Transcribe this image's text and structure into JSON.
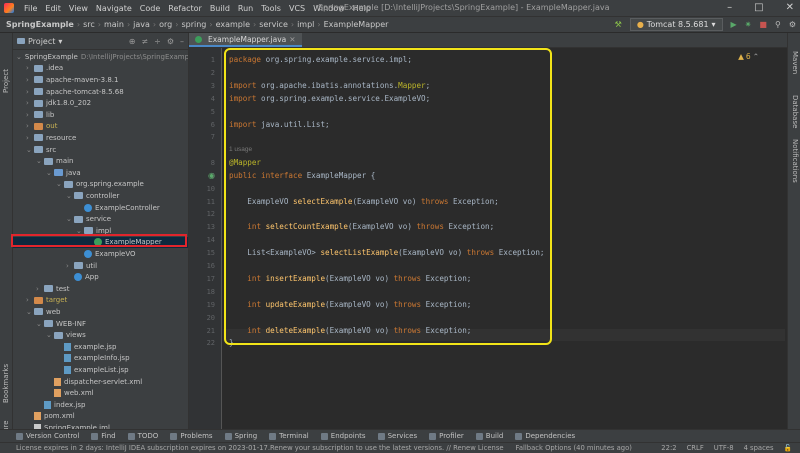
{
  "window": {
    "title": "SpringExample [D:\\IntelliJProjects\\SpringExample] - ExampleMapper.java"
  },
  "menu": [
    "File",
    "Edit",
    "View",
    "Navigate",
    "Code",
    "Refactor",
    "Build",
    "Run",
    "Tools",
    "VCS",
    "Window",
    "Help"
  ],
  "breadcrumbs": [
    "SpringExample",
    "src",
    "main",
    "java",
    "org",
    "spring",
    "example",
    "service",
    "impl",
    "ExampleMapper"
  ],
  "run_config": "Tomcat 8.5.681",
  "project_panel": {
    "title": "Project",
    "tree": [
      {
        "label": "SpringExample",
        "extra": "D:\\IntelliJProjects\\SpringExamp",
        "depth": 0,
        "icon": "folder",
        "open": true
      },
      {
        "label": ".idea",
        "depth": 1,
        "icon": "folder",
        "open": false
      },
      {
        "label": "apache-maven-3.8.1",
        "depth": 1,
        "icon": "folder",
        "open": false
      },
      {
        "label": "apache-tomcat-8.5.68",
        "depth": 1,
        "icon": "folder",
        "open": false
      },
      {
        "label": "jdk1.8.0_202",
        "depth": 1,
        "icon": "folder",
        "open": false
      },
      {
        "label": "lib",
        "depth": 1,
        "icon": "folder",
        "open": false
      },
      {
        "label": "out",
        "depth": 1,
        "icon": "folder-orange",
        "open": false
      },
      {
        "label": "resource",
        "depth": 1,
        "icon": "folder",
        "open": false
      },
      {
        "label": "src",
        "depth": 1,
        "icon": "folder",
        "open": true
      },
      {
        "label": "main",
        "depth": 2,
        "icon": "folder",
        "open": true
      },
      {
        "label": "java",
        "depth": 3,
        "icon": "folder-blue",
        "open": true
      },
      {
        "label": "org.spring.example",
        "depth": 4,
        "icon": "folder",
        "open": true
      },
      {
        "label": "controller",
        "depth": 5,
        "icon": "folder",
        "open": true
      },
      {
        "label": "ExampleController",
        "depth": 6,
        "icon": "class"
      },
      {
        "label": "service",
        "depth": 5,
        "icon": "folder",
        "open": true
      },
      {
        "label": "impl",
        "depth": 6,
        "icon": "folder",
        "open": true
      },
      {
        "label": "ExampleMapper",
        "depth": 7,
        "icon": "interface",
        "selected": true
      },
      {
        "label": "ExampleVO",
        "depth": 6,
        "icon": "class"
      },
      {
        "label": "util",
        "depth": 5,
        "icon": "folder",
        "open": false
      },
      {
        "label": "App",
        "depth": 5,
        "icon": "class"
      },
      {
        "label": "test",
        "depth": 2,
        "icon": "folder",
        "open": false
      },
      {
        "label": "target",
        "depth": 1,
        "icon": "folder-orange",
        "open": false
      },
      {
        "label": "web",
        "depth": 1,
        "icon": "folder",
        "open": true
      },
      {
        "label": "WEB-INF",
        "depth": 2,
        "icon": "folder",
        "open": true
      },
      {
        "label": "views",
        "depth": 3,
        "icon": "folder",
        "open": true
      },
      {
        "label": "example.jsp",
        "depth": 4,
        "icon": "jsp"
      },
      {
        "label": "exampleInfo.jsp",
        "depth": 4,
        "icon": "jsp"
      },
      {
        "label": "exampleList.jsp",
        "depth": 4,
        "icon": "jsp"
      },
      {
        "label": "dispatcher-servlet.xml",
        "depth": 3,
        "icon": "xml"
      },
      {
        "label": "web.xml",
        "depth": 3,
        "icon": "xml"
      },
      {
        "label": "index.jsp",
        "depth": 2,
        "icon": "jsp"
      },
      {
        "label": "pom.xml",
        "depth": 1,
        "icon": "xml"
      },
      {
        "label": "SpringExample.iml",
        "depth": 1,
        "icon": "file"
      }
    ]
  },
  "left_strip": [
    "Project",
    "Bookmarks",
    "Structure"
  ],
  "right_strip": [
    "Maven",
    "Database",
    "Notifications"
  ],
  "editor": {
    "tab": "ExampleMapper.java",
    "warnings": "6",
    "usage_hint": "1 usage",
    "lines": [
      {
        "n": "1",
        "html": "<span class=\"kw\">package</span> org.spring.example.service.impl;"
      },
      {
        "n": "2",
        "html": ""
      },
      {
        "n": "3",
        "html": "<span class=\"kw\">import</span> org.apache.ibatis.annotations.<span class=\"ann\">Mapper</span>;"
      },
      {
        "n": "4",
        "html": "<span class=\"kw\">import</span> org.spring.example.service.ExampleVO;"
      },
      {
        "n": "5",
        "html": ""
      },
      {
        "n": "6",
        "html": "<span class=\"kw\">import</span> java.util.List;"
      },
      {
        "n": "7",
        "html": ""
      },
      {
        "n": "8",
        "html": "<span class=\"ann\">@Mapper</span>"
      },
      {
        "n": "9",
        "html": "<span class=\"kw\">public interface</span> ExampleMapper {"
      },
      {
        "n": "10",
        "html": ""
      },
      {
        "n": "11",
        "html": "    ExampleVO <span class=\"fn\">selectExample</span>(ExampleVO vo) <span class=\"kw\">throws</span> Exception;"
      },
      {
        "n": "12",
        "html": ""
      },
      {
        "n": "13",
        "html": "    <span class=\"kw\">int</span> <span class=\"fn\">selectCountExample</span>(ExampleVO vo) <span class=\"kw\">throws</span> Exception;"
      },
      {
        "n": "14",
        "html": ""
      },
      {
        "n": "15",
        "html": "    List&lt;ExampleVO&gt; <span class=\"fn\">selectListExample</span>(ExampleVO vo) <span class=\"kw\">throws</span> Exception;"
      },
      {
        "n": "16",
        "html": ""
      },
      {
        "n": "17",
        "html": "    <span class=\"kw\">int</span> <span class=\"fn\">insertExample</span>(ExampleVO vo) <span class=\"kw\">throws</span> Exception;"
      },
      {
        "n": "18",
        "html": ""
      },
      {
        "n": "19",
        "html": "    <span class=\"kw\">int</span> <span class=\"fn\">updateExample</span>(ExampleVO vo) <span class=\"kw\">throws</span> Exception;"
      },
      {
        "n": "20",
        "html": ""
      },
      {
        "n": "21",
        "html": "    <span class=\"kw\">int</span> <span class=\"fn\">deleteExample</span>(ExampleVO vo) <span class=\"kw\">throws</span> Exception;"
      },
      {
        "n": "22",
        "html": "}"
      }
    ]
  },
  "bottom_tools": [
    "Version Control",
    "Find",
    "TODO",
    "Problems",
    "Spring",
    "Terminal",
    "Endpoints",
    "Services",
    "Profiler",
    "Build",
    "Dependencies"
  ],
  "status": {
    "message": "License expires in 2 days: IntelliJ IDEA subscription expires on 2023-01-17.Renew your subscription to use the latest versions. // Renew License",
    "fallback": "Fallback Options (40 minutes ago)",
    "position": "22:2",
    "line_sep": "CRLF",
    "encoding": "UTF-8",
    "indent": "4 spaces"
  }
}
